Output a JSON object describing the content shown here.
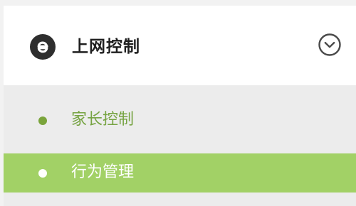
{
  "menu": {
    "section": {
      "title": "上网控制",
      "icon": "internet-explorer-e-icon",
      "toggle_icon": "chevron-down-circle-icon"
    },
    "items": [
      {
        "label": "家长控制",
        "selected": false,
        "bullet_color": "#7aa43b"
      },
      {
        "label": "行为管理",
        "selected": true,
        "bullet_color": "#ffffff"
      }
    ]
  },
  "colors": {
    "accent": "#a2d166",
    "inactive_text": "#76a342",
    "submenu_background": "#ececec",
    "header_background": "#ffffff",
    "icon_dark": "#2e2e2e"
  }
}
